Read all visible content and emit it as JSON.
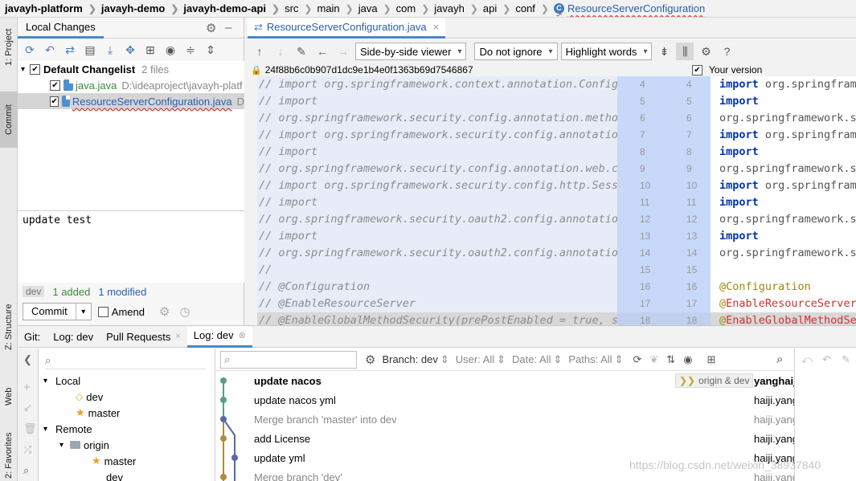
{
  "breadcrumb": {
    "items": [
      "javayh-platform",
      "javayh-demo",
      "javayh-demo-api",
      "src",
      "main",
      "java",
      "com",
      "javayh",
      "api",
      "conf"
    ],
    "current": "ResourceServerConfiguration"
  },
  "left_strip": {
    "project": "1: Project",
    "commit": "Commit",
    "structure": "Z: Structure",
    "web": "Web",
    "favorites": "2: Favorites"
  },
  "commit_panel": {
    "tab": "Local Changes",
    "changelist": {
      "name": "Default Changelist",
      "count": "2 files"
    },
    "files": [
      {
        "name": "java.java",
        "path": "D:\\ideaproject\\javayh-platf"
      },
      {
        "name": "ResourceServerConfiguration.java",
        "path": "D"
      }
    ],
    "message": "update test",
    "status": {
      "branch": "dev",
      "added": "1 added",
      "modified": "1 modified"
    },
    "commit_label": "Commit",
    "amend_label": "Amend"
  },
  "diff": {
    "tab": "ResourceServerConfiguration.java",
    "viewer": "Side-by-side viewer",
    "ignore": "Do not ignore",
    "highlight": "Highlight words",
    "hash": "24f88b6c0b907d1dc9e1b4e0f1363b69d7546867",
    "your_version": "Your version",
    "left_lines": [
      "// import org.springframework.context.annotation.Config",
      "// import",
      "// org.springframework.security.config.annotation.metho",
      "// import org.springframework.security.config.annotatio",
      "// import",
      "// org.springframework.security.config.annotation.web.c",
      "// import org.springframework.security.config.http.Sess",
      "// import",
      "// org.springframework.security.oauth2.config.annotatio",
      "// import",
      "// org.springframework.security.oauth2.config.annotatio",
      "//",
      "// @Configuration",
      "// @EnableResourceServer",
      "// @EnableGlobalMethodSecurity(prePostEnabled = true, s"
    ],
    "gutter": [
      [
        "4",
        "4"
      ],
      [
        "5",
        "5"
      ],
      [
        "6",
        "6"
      ],
      [
        "7",
        "7"
      ],
      [
        "8",
        "8"
      ],
      [
        "9",
        "9"
      ],
      [
        "10",
        "10"
      ],
      [
        "11",
        "11"
      ],
      [
        "12",
        "12"
      ],
      [
        "13",
        "13"
      ],
      [
        "14",
        "14"
      ],
      [
        "15",
        "15"
      ],
      [
        "16",
        "16"
      ],
      [
        "17",
        "17"
      ],
      [
        "18",
        "18"
      ]
    ],
    "right_lines": [
      {
        "kw": "import",
        "rest": " org.springframe"
      },
      {
        "kw": "import",
        "rest": ""
      },
      {
        "kw": "",
        "rest": "org.springframework.se"
      },
      {
        "kw": "import",
        "rest": " org.springframe"
      },
      {
        "kw": "import",
        "rest": ""
      },
      {
        "kw": "",
        "rest": "org.springframework.se"
      },
      {
        "kw": "import",
        "rest": " org.springframe"
      },
      {
        "kw": "import",
        "rest": ""
      },
      {
        "kw": "",
        "rest": "org.springframework.se"
      },
      {
        "kw": "import",
        "rest": ""
      },
      {
        "kw": "",
        "rest": "org.springframework.se"
      },
      {
        "kw": "",
        "rest": ""
      },
      {
        "ann": "@Configuration"
      },
      {
        "ann_at": "@",
        "red": "EnableResourceServer"
      },
      {
        "ann_at": "@",
        "red": "EnableGlobalMethodSec"
      }
    ]
  },
  "git": {
    "tabs": [
      "Git:",
      "Log: dev",
      "Pull Requests",
      "Log: dev"
    ],
    "branches": {
      "local": "Local",
      "local_items": [
        "dev",
        "master"
      ],
      "remote": "Remote",
      "origin": "origin",
      "origin_items": [
        "master",
        "dev"
      ]
    },
    "filters": {
      "branch": "Branch: dev",
      "user": "User: All",
      "date": "Date: All",
      "paths": "Paths: All"
    },
    "log": [
      {
        "msg": "update nacos",
        "author": "yanghaiji",
        "bold": true
      },
      {
        "msg": "update nacos yml",
        "author": "haiji.yang"
      },
      {
        "msg": "Merge branch 'master' into dev",
        "author": "haiji.yang",
        "gray": true
      },
      {
        "msg": "add License",
        "author": "haiji.yang"
      },
      {
        "msg": "update yml",
        "author": "haiji.yang"
      },
      {
        "msg": "Merge branch 'dev'",
        "author": "haiji.yang",
        "gray": true
      }
    ],
    "refs": "origin & dev",
    "colors": {
      "graph_green": "#5a9f7e",
      "graph_blue": "#5868a8",
      "graph_gold": "#b08a3e"
    }
  },
  "watermark": "https://blog.csdn.net/weixin_38937840"
}
